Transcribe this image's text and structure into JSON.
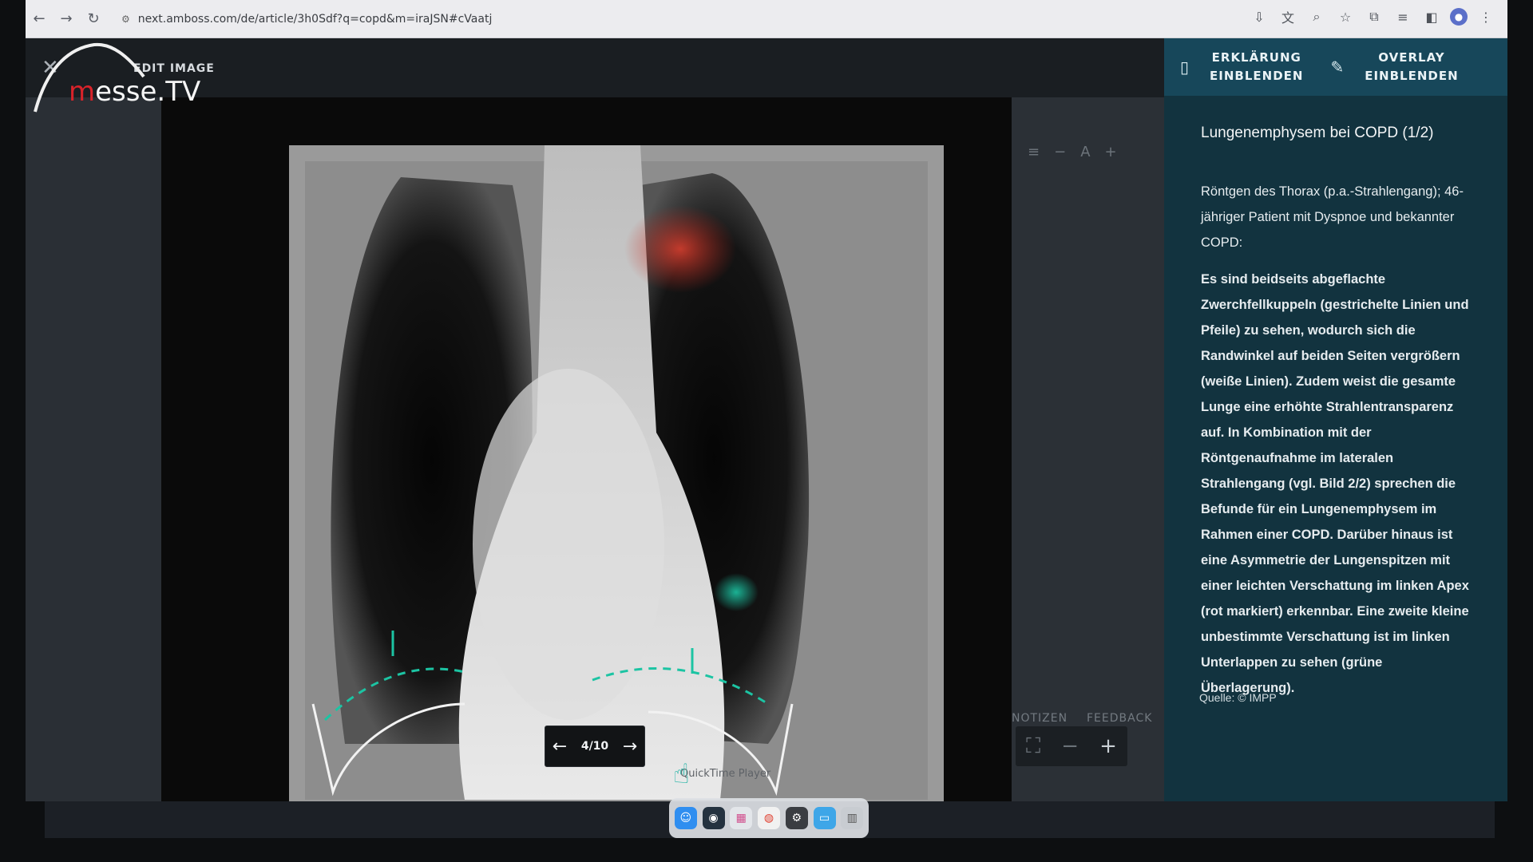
{
  "browser": {
    "url": "next.amboss.com/de/article/3h0Sdf?q=copd&m=iraJSN#cVaatj"
  },
  "viewer": {
    "edit_label": "EDIT IMAGE",
    "pager": "4/10",
    "tabs": [
      "NOTIZEN",
      "FEEDBACK"
    ],
    "player_label": "QuickTime Player"
  },
  "logo": {
    "red": "m",
    "word": "esse.TV"
  },
  "rightbar": {
    "btn_explain": "ERKLÄRUNG\nEINBLENDEN",
    "btn_overlay": "OVERLAY\nEINBLENDEN",
    "title": "Lungenemphysem bei COPD (1/2)",
    "intro": "Röntgen des Thorax (p.a.-Strahlengang); 46-jähriger Patient mit Dyspnoe und bekannter COPD:",
    "body": "Es sind beidseits abgeflachte Zwerchfellkuppeln (gestrichelte Linien und Pfeile) zu sehen, wodurch sich die Randwinkel auf beiden Seiten vergrößern (weiße Linien). Zudem weist die gesamte Lunge eine erhöhte Strahlentransparenz auf. In Kombination mit der Röntgenaufnahme im lateralen Strahlengang (vgl. Bild 2/2) sprechen die Befunde für ein Lungenemphysem im Rahmen einer COPD. Darüber hinaus ist eine Asymmetrie der Lungenspitzen mit einer leichten Verschattung im linken Apex (rot markiert) erkennbar. Eine zweite kleine unbestimmte Verschattung ist im linken Unterlappen zu sehen (grüne Überlagerung).",
    "source": "Quelle: © IMPP"
  },
  "colors": {
    "accent": "#17475a",
    "panel": "#12333f",
    "overlay_red": "#d83b2f",
    "overlay_green": "#1cc4a3"
  }
}
